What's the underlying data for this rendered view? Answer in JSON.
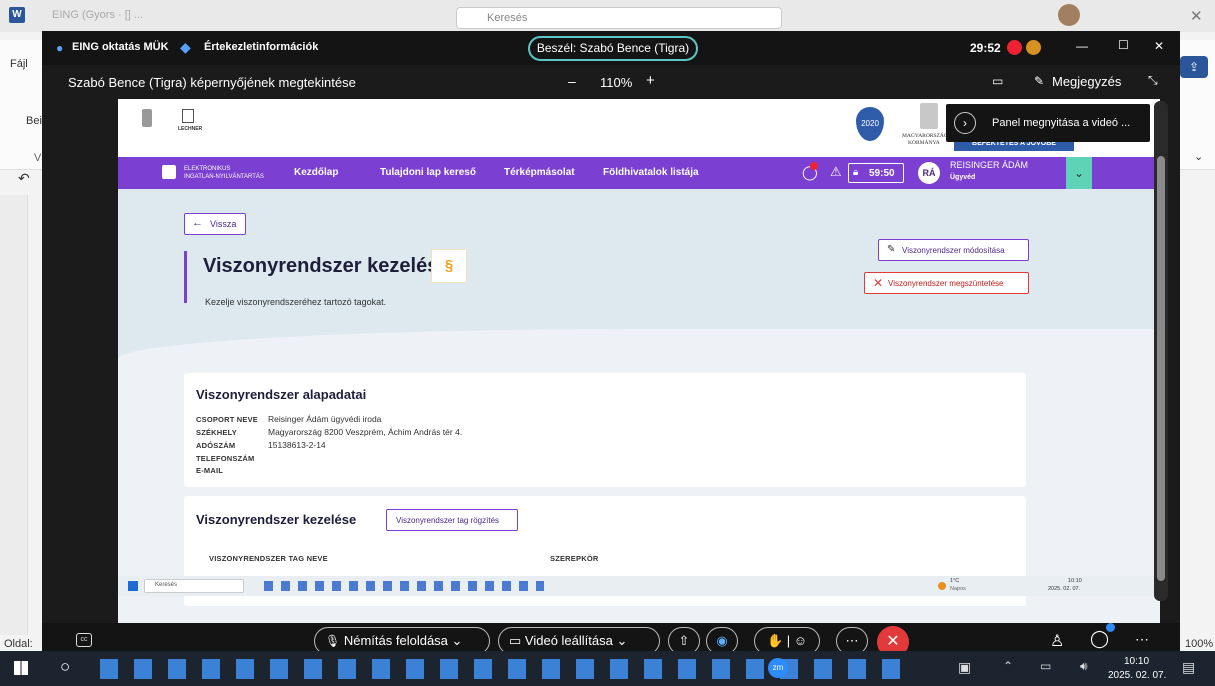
{
  "word": {
    "tab_file": "Fájl",
    "title_blur": "EING (Gyors · [] ...",
    "search_blur": "Keresés",
    "beill": "Beill",
    "va": "Vá",
    "status_left": "Oldal:",
    "zoom": "100%"
  },
  "teams": {
    "app_name": "EING oktatás MÜK",
    "meeting_info": "Értekezletinformációk",
    "speaker": "Beszél: Szabó Bence (Tigra)",
    "timer": "29:52",
    "viewing": "Szabó Bence (Tigra) képernyőjének megtekintése",
    "zoom_minus": "–",
    "zoom": "110%",
    "zoom_plus": "+",
    "note": "Megjegyzés",
    "panel_tip": "Panel megnyitása a videó ...",
    "unmute": "Némítás feloldása",
    "stop_video": "Videó leállítása"
  },
  "site": {
    "logo_top": "ELEKTRONIKUS",
    "logo_bottom": "INGATLAN-NYILVÁNTARTÁS",
    "nav": [
      "Kezdőlap",
      "Tulajdoni lap kereső",
      "Térképmásolat",
      "Földhivatalok listája"
    ],
    "session": "59:50",
    "avatar": "RÁ",
    "user_name": "REISINGER ÁDÁM",
    "user_role": "Ügyvéd",
    "lechner": "LECHNER",
    "year": "2020",
    "gov1": "MAGYARORSZÁG",
    "gov2": "KORMÁNYA",
    "banner": "BEFEKTETÉS A JÖVŐBE",
    "back": "Vissza",
    "page_title": "Viszonyrendszer kezelés",
    "section_sign": "§",
    "subtitle": "Kezelje viszonyrendszeréhez tartozó tagokat.",
    "btn_modify": "Viszonyrendszer módosítása",
    "btn_terminate": "Viszonyrendszer megszüntetése",
    "card1_title": "Viszonyrendszer alapadatai",
    "fields": [
      {
        "label": "CSOPORT NEVE",
        "value": "Reisinger Ádám ügyvédi iroda"
      },
      {
        "label": "SZÉKHELY",
        "value": "Magyarország 8200 Veszprém, Áchim András tér 4."
      },
      {
        "label": "ADÓSZÁM",
        "value": "15138613-2-14"
      },
      {
        "label": "TELEFONSZÁM",
        "value": ""
      },
      {
        "label": "E-MAIL",
        "value": ""
      }
    ],
    "card2_title": "Viszonyrendszer kezelése",
    "btn_add_member": "Viszonyrendszer tag rögzítés",
    "col_name": "VISZONYRENDSZER TAG NEVE",
    "col_role": "SZEREPKÖR",
    "inner_search": "Keresés",
    "inner_temp": "1°C",
    "inner_weather": "Napos",
    "inner_time": "10:10",
    "inner_date": "2025. 02. 07."
  },
  "taskbar": {
    "time": "10:10",
    "date": "2025. 02. 07.",
    "zm": "zm"
  }
}
